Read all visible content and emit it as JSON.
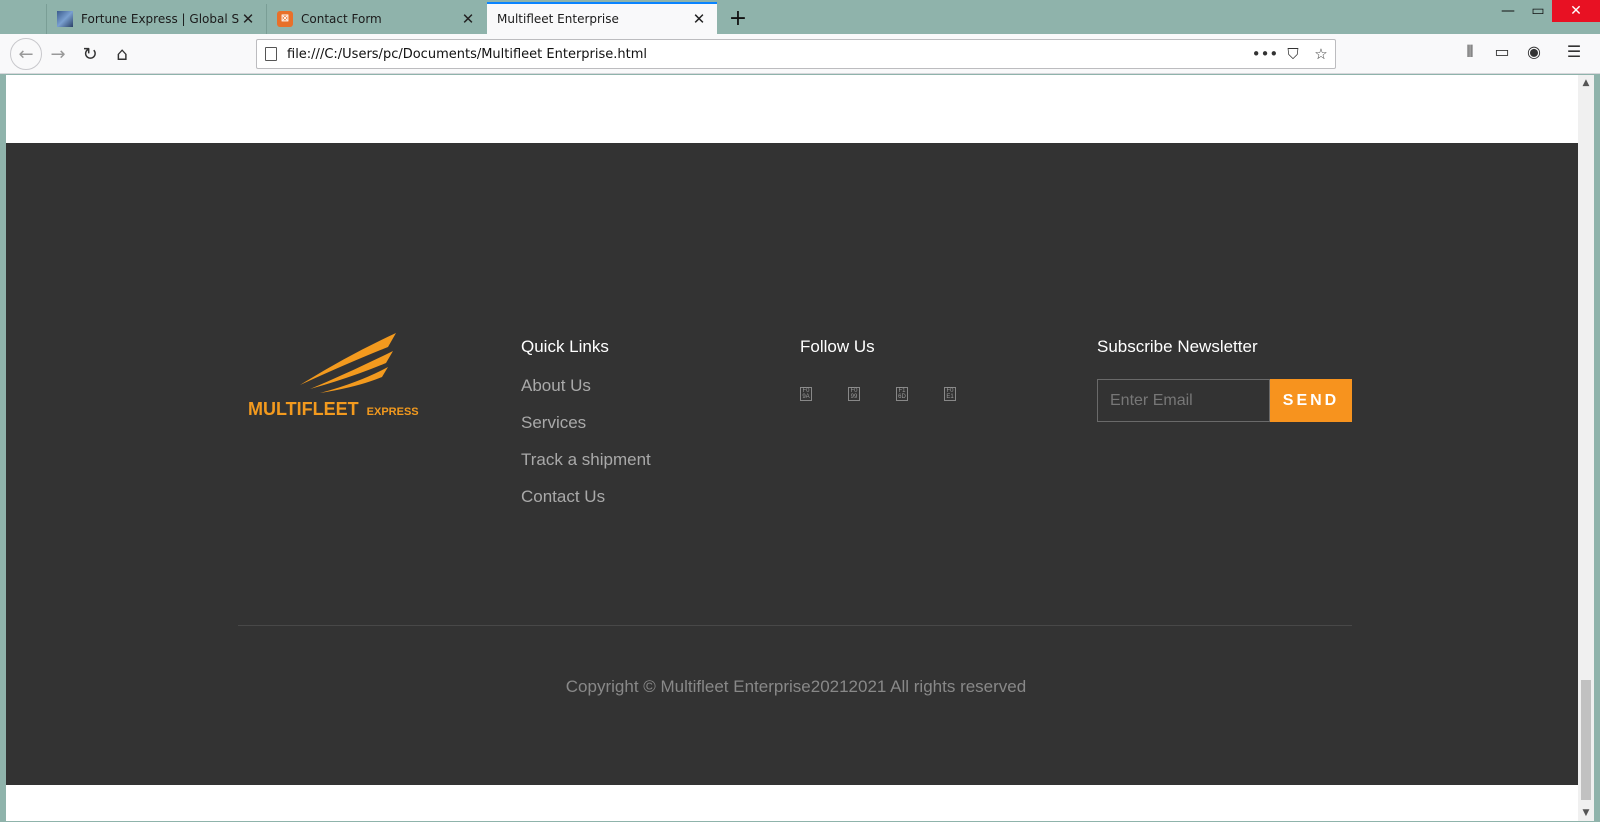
{
  "browser": {
    "tabs": [
      {
        "title": "Fortune Express | Global Shippi",
        "favicon": "fortune-favicon"
      },
      {
        "title": "Contact Form",
        "favicon": "xampp-favicon"
      },
      {
        "title": "Multifleet Enterprise",
        "favicon": "none",
        "active": true
      }
    ],
    "url": "file:///C:/Users/pc/Documents/Multifleet Enterprise.html",
    "icons": {
      "back": "←",
      "forward": "→",
      "reload": "↻",
      "home": "⌂",
      "page_actions": "•••",
      "pocket": "⛉",
      "bookmark": "☆",
      "library": "⫴",
      "sidebar": "▭",
      "account": "◉",
      "menu": "☰",
      "new_tab": "+",
      "close_tab": "✕",
      "minimize": "—",
      "maximize": "▭",
      "close_window": "✕"
    }
  },
  "footer": {
    "logo": {
      "name": "MULTIFLEET",
      "sub": "EXPRESS"
    },
    "quick_links": {
      "title": "Quick Links",
      "items": [
        "About Us",
        "Services",
        "Track a shipment",
        "Contact Us"
      ]
    },
    "follow": {
      "title": "Follow Us",
      "icons": [
        "facebook-icon",
        "twitter-icon",
        "instagram-icon",
        "linkedin-icon"
      ]
    },
    "newsletter": {
      "title": "Subscribe Newsletter",
      "placeholder": "Enter Email",
      "button": "SEND"
    },
    "copyright": "Copyright © Multifleet Enterprise20212021 All rights reserved"
  },
  "colors": {
    "footer_bg": "#333333",
    "accent": "#f7931e"
  }
}
